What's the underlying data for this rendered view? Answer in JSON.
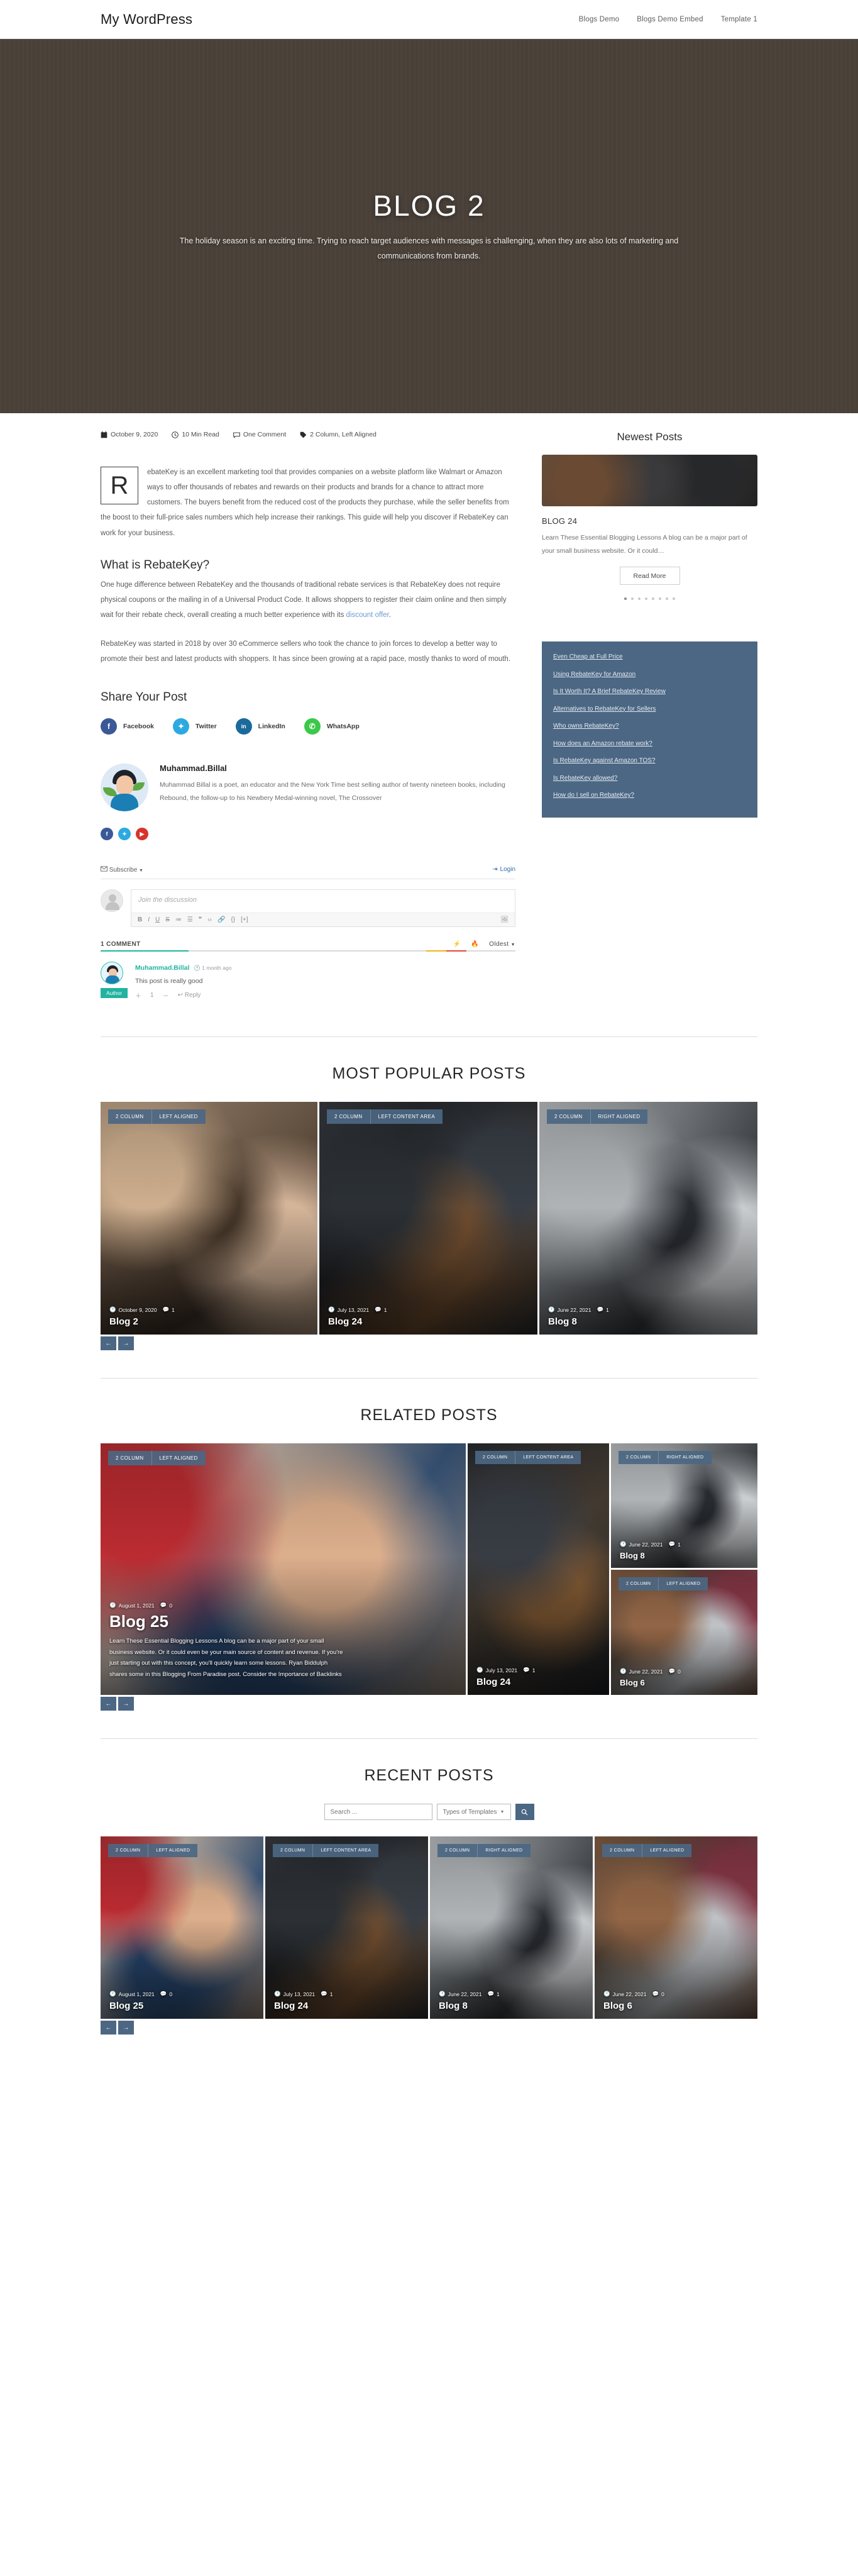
{
  "header": {
    "site_title": "My WordPress",
    "nav": [
      {
        "label": "Blogs Demo"
      },
      {
        "label": "Blogs Demo Embed"
      },
      {
        "label": "Template 1"
      }
    ]
  },
  "hero": {
    "title": "BLOG 2",
    "subtitle": "The holiday season is an exciting time. Trying to reach target audiences with messages is challenging, when they are also lots of marketing and communications from brands."
  },
  "post_meta": {
    "date": "October 9, 2020",
    "read_time": "10 Min Read",
    "comments": "One Comment",
    "tags": "2 Column, Left Aligned"
  },
  "article": {
    "dropcap": "R",
    "lead": "ebateKey is an excellent marketing tool that provides companies on a website platform like Walmart or Amazon ways to offer thousands of rebates and rewards on their products and brands for a chance to attract more customers. The buyers benefit from the reduced cost of the products they purchase, while the seller benefits from the boost to their full-price sales numbers which help increase their rankings. This guide will help you discover if RebateKey can work for your business.",
    "heading": "What is RebateKey?",
    "para1_before": "One huge difference between RebateKey and the thousands of traditional rebate services is that RebateKey does not require physical coupons or the mailing in of a Universal Product Code. It allows shoppers to register their claim online and then simply wait for their rebate check, overall creating a much better experience with its ",
    "para1_link": "discount offer",
    "para1_after": ".",
    "para2": "RebateKey was started in 2018 by over 30 eCommerce sellers who took the chance to join forces to develop a better way to promote their best and latest products with shoppers. It has since been growing at a rapid pace, mostly thanks to word of mouth."
  },
  "share": {
    "heading": "Share Your Post",
    "buttons": [
      {
        "label": "Facebook",
        "glyph": "f",
        "color": "#3b5998"
      },
      {
        "label": "Twitter",
        "glyph": "t",
        "color": "#2ca9e1"
      },
      {
        "label": "LinkedIn",
        "glyph": "in",
        "color": "#1b6a9c"
      },
      {
        "label": "WhatsApp",
        "glyph": "w",
        "color": "#3cc84a"
      }
    ]
  },
  "author": {
    "name": "Muhammad.Billal",
    "bio": "Muhammad Billal is a poet, an educator and the New York Time best selling author of twenty nineteen books, including Rebound, the follow-up to his Newbery Medal-winning novel, The Crossover",
    "socials": [
      {
        "glyph": "f",
        "color": "#3b5998"
      },
      {
        "glyph": "t",
        "color": "#2ca9e1"
      },
      {
        "glyph": "y",
        "color": "#d6342c"
      }
    ]
  },
  "comments": {
    "subscribe_label": "Subscribe",
    "login_label": "Login",
    "input_placeholder": "Join the discussion",
    "toolbar_icons": [
      "B",
      "I",
      "U",
      "S",
      "list-ordered",
      "list-bullet",
      "quote",
      "code",
      "link",
      "{}",
      "[+]",
      "image"
    ],
    "count_label": "1 COMMENT",
    "sort_label": "Oldest",
    "items": [
      {
        "name": "Muhammad.Billal",
        "time": "1 month ago",
        "text": "This post is really good",
        "badge": "Author",
        "votes": "1",
        "reply_label": "Reply"
      }
    ]
  },
  "sidebar": {
    "newest_heading": "Newest Posts",
    "card": {
      "title": "BLOG 24",
      "excerpt": "Learn These Essential Blogging Lessons A blog can be a major part of your small business website. Or it could…",
      "read_more": "Read More"
    },
    "toc_links": [
      "Even Cheap at Full Price",
      "Using RebateKey for Amazon",
      "Is It Worth It? A Brief RebateKey Review",
      "Alternatives to RebateKey for Sellers",
      "Who owns RebateKey?",
      "How does an Amazon rebate work?",
      "Is RebateKey against Amazon TOS?",
      "Is RebateKey allowed?",
      "How do I sell on RebateKey?"
    ]
  },
  "popular": {
    "heading": "MOST POPULAR POSTS",
    "cards": [
      {
        "tags": [
          "2 COLUMN",
          "LEFT ALIGNED"
        ],
        "date": "October 9, 2020",
        "comments": "1",
        "title": "Blog 2",
        "img": "img-blog2"
      },
      {
        "tags": [
          "2 COLUMN",
          "LEFT CONTENT AREA"
        ],
        "date": "July 13, 2021",
        "comments": "1",
        "title": "Blog 24",
        "img": "img-blog24"
      },
      {
        "tags": [
          "2 COLUMN",
          "RIGHT ALIGNED"
        ],
        "date": "June 22, 2021",
        "comments": "1",
        "title": "Blog 8",
        "img": "img-blog8"
      }
    ]
  },
  "related": {
    "heading": "RELATED POSTS",
    "feature": {
      "tags": [
        "2 COLUMN",
        "LEFT ALIGNED"
      ],
      "date": "August 1, 2021",
      "comments": "0",
      "title": "Blog 25",
      "excerpt": "Learn These Essential Blogging Lessons A blog can be a major part of your small business website. Or it could even be your main source of content and revenue. If you're just starting out with this concept, you'll quickly learn some lessons. Ryan Biddulph shares some in this Blogging From Paradise post. Consider the Importance of Backlinks",
      "img": "img-blog25"
    },
    "middle": {
      "tags": [
        "2 COLUMN",
        "LEFT CONTENT AREA"
      ],
      "date": "July 13, 2021",
      "comments": "1",
      "title": "Blog 24",
      "img": "img-blog24b"
    },
    "right": [
      {
        "tags": [
          "2 COLUMN",
          "RIGHT ALIGNED"
        ],
        "date": "June 22, 2021",
        "comments": "1",
        "title": "Blog 8",
        "img": "img-blog8"
      },
      {
        "tags": [
          "2 COLUMN",
          "LEFT ALIGNED"
        ],
        "date": "June 22, 2021",
        "comments": "0",
        "title": "Blog 6",
        "img": "img-blog6"
      }
    ]
  },
  "recent": {
    "heading": "RECENT POSTS",
    "search_placeholder": "Search ...",
    "select_value": "Types of Templates",
    "cards": [
      {
        "tags": [
          "2 COLUMN",
          "LEFT ALIGNED"
        ],
        "date": "August 1, 2021",
        "comments": "0",
        "title": "Blog 25",
        "img": "img-blog25"
      },
      {
        "tags": [
          "2 COLUMN",
          "LEFT CONTENT AREA"
        ],
        "date": "July 13, 2021",
        "comments": "1",
        "title": "Blog 24",
        "img": "img-blog24"
      },
      {
        "tags": [
          "2 COLUMN",
          "RIGHT ALIGNED"
        ],
        "date": "June 22, 2021",
        "comments": "1",
        "title": "Blog 8",
        "img": "img-blog8"
      },
      {
        "tags": [
          "2 COLUMN",
          "LEFT ALIGNED"
        ],
        "date": "June 22, 2021",
        "comments": "0",
        "title": "Blog 6",
        "img": "img-blog6"
      }
    ]
  },
  "carousel": {
    "prev": "←",
    "next": "→"
  },
  "colors": {
    "accent": "#4c6783",
    "teal": "#22b3a0",
    "link": "#6b9bd1"
  }
}
